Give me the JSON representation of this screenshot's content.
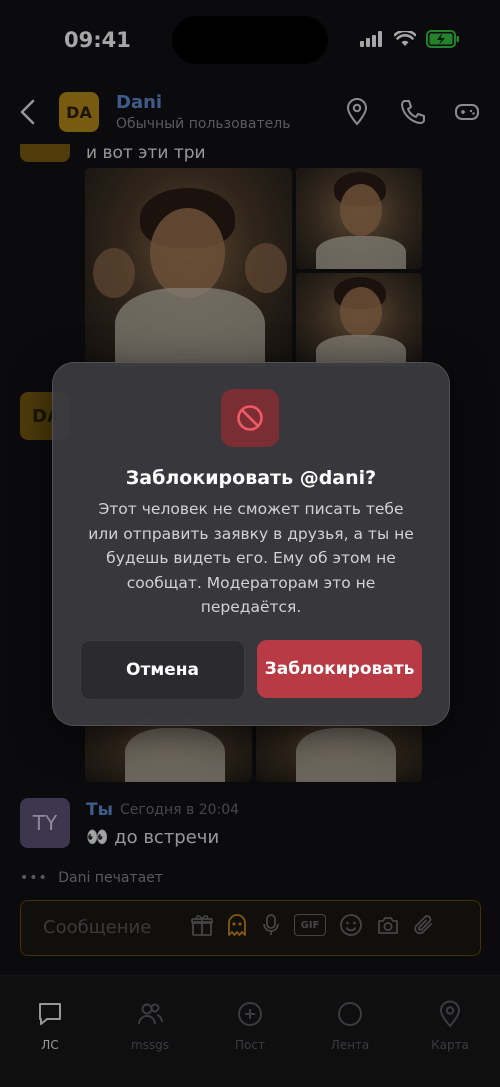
{
  "status_bar": {
    "time": "09:41"
  },
  "header": {
    "avatar_initials": "DA",
    "name": "Dani",
    "subtitle": "Обычный пользователь",
    "icons": [
      "location-pin-icon",
      "phone-icon",
      "gamepad-icon"
    ]
  },
  "chat": {
    "msg1_text": "и вот эти три",
    "dani_avatar_peek": "DA",
    "ty_avatar": "TY",
    "ty_name": "Ты",
    "ty_time": "Сегодня в 20:04",
    "ty_message": "👀 до встречи",
    "typing": "Dani печатает"
  },
  "composer": {
    "placeholder": "Сообщение",
    "icons": [
      "gift-icon",
      "ghost-icon",
      "mic-icon",
      "gif-icon",
      "smile-icon",
      "camera-icon",
      "paperclip-icon"
    ],
    "gif_label": "GIF"
  },
  "dialog": {
    "title": "Заблокировать @dani?",
    "body": "Этот человек не сможет писать тебе\nили отправить заявку в друзья, а ты не\nбудешь видеть его. Ему об этом не\nсообщат. Модераторам это не\nпередаётся.",
    "cancel_label": "Отмена",
    "confirm_label": "Заблокировать",
    "accent_color": "#b83a44"
  },
  "tabs": [
    {
      "label": "ЛС",
      "icon": "chat-bubble-icon",
      "active": true
    },
    {
      "label": "mssgs",
      "icon": "users-icon",
      "active": false
    },
    {
      "label": "Пост",
      "icon": "plus-circle-icon",
      "active": false
    },
    {
      "label": "Лента",
      "icon": "circle-icon",
      "active": false
    },
    {
      "label": "Карта",
      "icon": "map-pin-icon",
      "active": false
    }
  ]
}
